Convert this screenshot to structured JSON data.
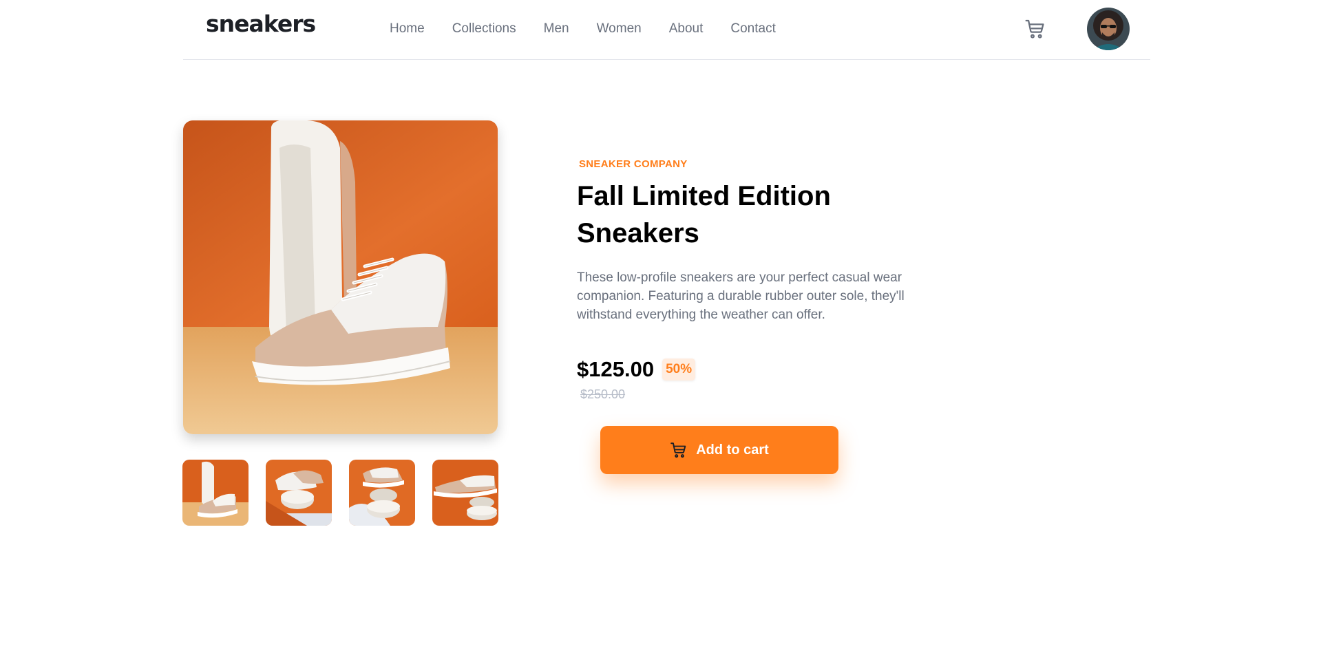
{
  "header": {
    "logo": "sneakers",
    "nav": [
      "Home",
      "Collections",
      "Men",
      "Women",
      "About",
      "Contact"
    ],
    "cart_icon": "cart-icon",
    "avatar_icon": "user-avatar"
  },
  "gallery": {
    "main_image": "white sneaker product photo on orange background",
    "thumbnails": [
      "product-1-thumbnail",
      "product-2-thumbnail",
      "product-3-thumbnail",
      "product-4-thumbnail"
    ]
  },
  "product": {
    "company": "SNEAKER COMPANY",
    "title": "Fall Limited Edition Sneakers",
    "description": "These low-profile sneakers are your perfect casual wear companion. Featuring a durable rubber outer sole, they'll withstand everything the weather can offer.",
    "price": "$125.00",
    "discount": "50%",
    "original_price": "$250.00",
    "add_to_cart_label": "Add to cart"
  },
  "colors": {
    "accent": "#ff7e1b",
    "accent_pale": "#ffede0",
    "text_dark": "#1d2026",
    "text_muted": "#69707d",
    "text_faint": "#b6bcc8"
  }
}
